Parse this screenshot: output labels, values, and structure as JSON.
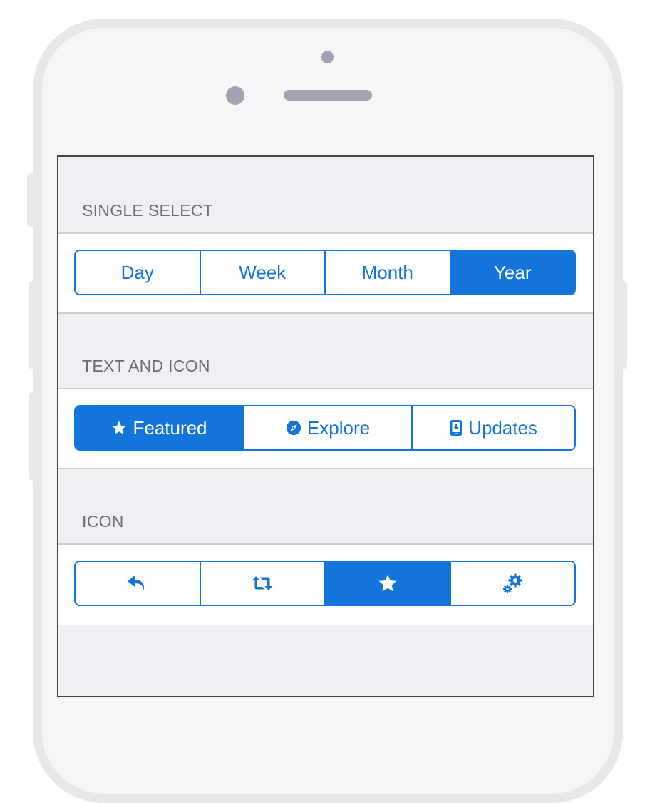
{
  "sections": [
    {
      "title": "SINGLE SELECT",
      "segments": [
        {
          "label": "Day",
          "active": false
        },
        {
          "label": "Week",
          "active": false
        },
        {
          "label": "Month",
          "active": false
        },
        {
          "label": "Year",
          "active": true
        }
      ]
    },
    {
      "title": "TEXT AND ICON",
      "segments": [
        {
          "label": "Featured",
          "icon": "star-icon",
          "active": true
        },
        {
          "label": "Explore",
          "icon": "compass-icon",
          "active": false
        },
        {
          "label": "Updates",
          "icon": "download-device-icon",
          "active": false
        }
      ]
    },
    {
      "title": "ICON",
      "segments": [
        {
          "icon": "reply-icon",
          "active": false
        },
        {
          "icon": "retweet-icon",
          "active": false
        },
        {
          "icon": "star-icon",
          "active": true
        },
        {
          "icon": "gears-icon",
          "active": false
        }
      ]
    }
  ],
  "colors": {
    "accent": "#1374dc",
    "header_text": "#6d6d72",
    "screen_bg": "#efeff4"
  }
}
